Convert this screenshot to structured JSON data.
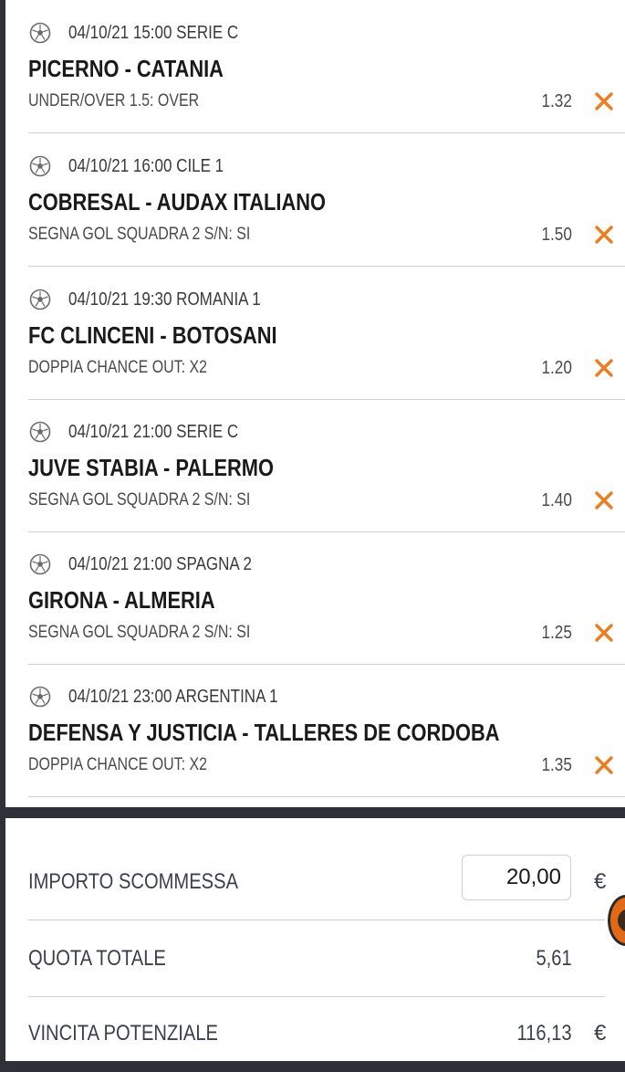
{
  "events": [
    {
      "meta": "04/10/21 15:00 SERIE C",
      "match": "PICERNO - CATANIA",
      "market": "UNDER/OVER 1.5: OVER",
      "odd": "1.32"
    },
    {
      "meta": "04/10/21 16:00 CILE 1",
      "match": "COBRESAL - AUDAX ITALIANO",
      "market": "SEGNA GOL SQUADRA 2 S/N: SI",
      "odd": "1.50"
    },
    {
      "meta": "04/10/21 19:30 ROMANIA 1",
      "match": "FC CLINCENI - BOTOSANI",
      "market": "DOPPIA CHANCE OUT: X2",
      "odd": "1.20"
    },
    {
      "meta": "04/10/21 21:00 SERIE C",
      "match": "JUVE STABIA - PALERMO",
      "market": "SEGNA GOL SQUADRA 2 S/N: SI",
      "odd": "1.40"
    },
    {
      "meta": "04/10/21 21:00 SPAGNA 2",
      "match": "GIRONA - ALMERIA",
      "market": "SEGNA GOL SQUADRA 2 S/N: SI",
      "odd": "1.25"
    },
    {
      "meta": "04/10/21 23:00 ARGENTINA 1",
      "match": "DEFENSA Y JUSTICIA - TALLERES DE CORDOBA",
      "market": "DOPPIA CHANCE OUT: X2",
      "odd": "1.35"
    }
  ],
  "summary": {
    "stake_label": "IMPORTO SCOMMESSA",
    "stake_value": "20,00",
    "currency": "€",
    "total_odds_label": "QUOTA TOTALE",
    "total_odds_value": "5,61",
    "potential_win_label": "VINCITA POTENZIALE",
    "potential_win_value": "116,13"
  },
  "icons": {
    "sport": "soccer-ball-icon",
    "remove": "close-x-icon"
  },
  "colors": {
    "accent": "#f07c1e",
    "background_dark": "#2e3138",
    "text_dark": "#1a1a1a",
    "text_muted": "#4a4a4a",
    "divider": "#cfcfcf"
  }
}
